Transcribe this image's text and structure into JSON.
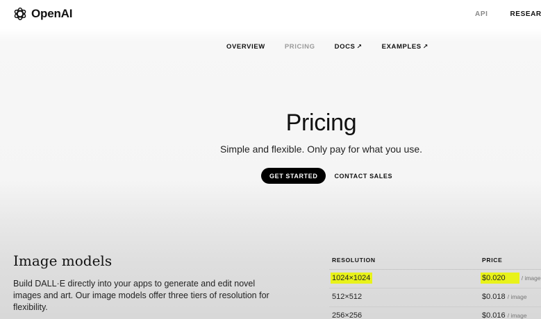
{
  "header": {
    "brand": "OpenAI",
    "links": [
      {
        "label": "API"
      },
      {
        "label": "RESEARCH"
      }
    ]
  },
  "subnav": {
    "items": [
      {
        "label": "OVERVIEW"
      },
      {
        "label": "PRICING",
        "active": true
      },
      {
        "label": "DOCS",
        "external": true
      },
      {
        "label": "EXAMPLES",
        "external": true
      }
    ],
    "external_icon": "↗"
  },
  "hero": {
    "title": "Pricing",
    "subtitle": "Simple and flexible. Only pay for what you use.",
    "primary_button": "GET STARTED",
    "secondary_link": "CONTACT SALES"
  },
  "image_models": {
    "title": "Image models",
    "description": "Build DALL·E directly into your apps to generate and edit novel images and art. Our image models offer three tiers of resolution for flexibility.",
    "table": {
      "headers": {
        "resolution": "RESOLUTION",
        "price": "PRICE"
      },
      "rows": [
        {
          "resolution": "1024×1024",
          "price": "$0.020",
          "unit": "/ image",
          "highlighted": true
        },
        {
          "resolution": "512×512",
          "price": "$0.018",
          "unit": "/ image"
        },
        {
          "resolution": "256×256",
          "price": "$0.016",
          "unit": "/ image"
        }
      ]
    }
  },
  "colors": {
    "highlight": "#e8f21a",
    "primary_button_bg": "#000000",
    "active_nav": "#9a9a9a"
  }
}
